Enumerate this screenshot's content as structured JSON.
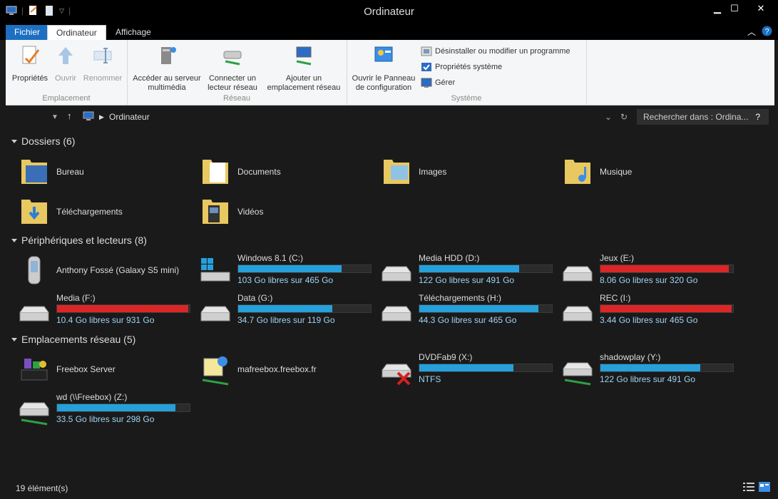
{
  "window": {
    "title": "Ordinateur"
  },
  "tabs": {
    "file": "Fichier",
    "computer": "Ordinateur",
    "view": "Affichage"
  },
  "ribbon": {
    "groups": [
      {
        "label": "Emplacement",
        "buttons": [
          {
            "label": "Propriétés",
            "icon": "properties-icon"
          },
          {
            "label": "Ouvrir",
            "icon": "open-icon"
          },
          {
            "label": "Renommer",
            "icon": "rename-icon"
          }
        ]
      },
      {
        "label": "Réseau",
        "buttons": [
          {
            "label": "Accéder au serveur multimédia",
            "icon": "media-server-icon"
          },
          {
            "label": "Connecter un lecteur réseau",
            "icon": "map-drive-icon"
          },
          {
            "label": "Ajouter un emplacement réseau",
            "icon": "add-network-icon"
          }
        ]
      },
      {
        "label": "Système",
        "buttons": [
          {
            "label": "Ouvrir le Panneau de configuration",
            "icon": "control-panel-icon"
          }
        ],
        "small": [
          {
            "label": "Désinstaller ou modifier un programme",
            "icon": "uninstall-icon"
          },
          {
            "label": "Propriétés système",
            "icon": "system-props-icon"
          },
          {
            "label": "Gérer",
            "icon": "manage-icon"
          }
        ]
      }
    ]
  },
  "address": {
    "location": "Ordinateur",
    "search_placeholder": "Rechercher dans : Ordina..."
  },
  "sections": {
    "folders": {
      "title": "Dossiers (6)",
      "items": [
        {
          "name": "Bureau"
        },
        {
          "name": "Documents"
        },
        {
          "name": "Images"
        },
        {
          "name": "Musique"
        },
        {
          "name": "Téléchargements"
        },
        {
          "name": "Vidéos"
        }
      ]
    },
    "devices": {
      "title": "Périphériques et lecteurs (8)",
      "items": [
        {
          "name": "Anthony Fossé (Galaxy S5 mini)",
          "type": "phone"
        },
        {
          "name": "Windows 8.1 (C:)",
          "sub": "103 Go libres sur 465 Go",
          "used": 0.78,
          "color": "#26a0da"
        },
        {
          "name": "Media HDD (D:)",
          "sub": "122 Go libres sur 491 Go",
          "used": 0.75,
          "color": "#26a0da"
        },
        {
          "name": "Jeux (E:)",
          "sub": "8.06 Go libres sur 320 Go",
          "used": 0.97,
          "color": "#da2626"
        },
        {
          "name": "Media (F:)",
          "sub": "10.4 Go libres sur 931 Go",
          "used": 0.99,
          "color": "#da2626"
        },
        {
          "name": "Data (G:)",
          "sub": "34.7 Go libres sur 119 Go",
          "used": 0.71,
          "color": "#26a0da"
        },
        {
          "name": "Téléchargements (H:)",
          "sub": "44.3 Go libres sur 465 Go",
          "used": 0.9,
          "color": "#26a0da"
        },
        {
          "name": "REC (I:)",
          "sub": "3.44 Go libres sur 465 Go",
          "used": 0.99,
          "color": "#da2626"
        }
      ]
    },
    "network": {
      "title": "Emplacements réseau (5)",
      "items": [
        {
          "name": "Freebox Server",
          "type": "media"
        },
        {
          "name": "mafreebox.freebox.fr",
          "type": "web"
        },
        {
          "name": "DVDFab9 (X:)",
          "sub": "NTFS",
          "used": 0.71,
          "color": "#26a0da",
          "disconnected": true
        },
        {
          "name": "shadowplay (Y:)",
          "sub": "122 Go libres sur 491 Go",
          "used": 0.75,
          "color": "#26a0da"
        },
        {
          "name": "wd (\\\\Freebox) (Z:)",
          "sub": "33.5 Go libres sur 298 Go",
          "used": 0.89,
          "color": "#26a0da"
        }
      ]
    }
  },
  "status": {
    "count": "19 élément(s)"
  }
}
